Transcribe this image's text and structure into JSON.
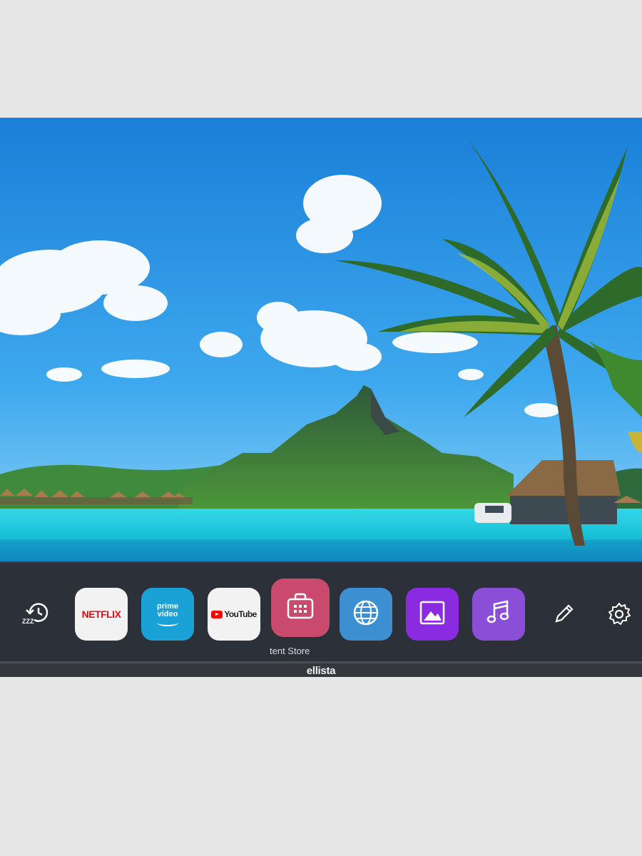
{
  "device": {
    "brand_logo": "ellista"
  },
  "launcher": {
    "focused_app_label": "tent Store",
    "items": [
      {
        "id": "recent",
        "icon": "recent-history-icon"
      },
      {
        "id": "netflix",
        "label": "NETFLIX",
        "color": "#e50914"
      },
      {
        "id": "prime",
        "label_line1": "prime",
        "label_line2": "video",
        "color": "#1aa1d6"
      },
      {
        "id": "youtube",
        "label": "YouTube",
        "color": "#ff0000"
      },
      {
        "id": "content-store",
        "icon": "shopping-bag-icon",
        "color": "#c94a6c"
      },
      {
        "id": "web-browser",
        "icon": "globe-icon",
        "color": "#3c8fd0"
      },
      {
        "id": "gallery",
        "icon": "image-icon",
        "color": "#8a2be2"
      },
      {
        "id": "music",
        "icon": "music-note-icon",
        "color": "#8a4fd6"
      },
      {
        "id": "edit",
        "icon": "pencil-icon"
      },
      {
        "id": "settings",
        "icon": "gear-icon"
      }
    ]
  }
}
